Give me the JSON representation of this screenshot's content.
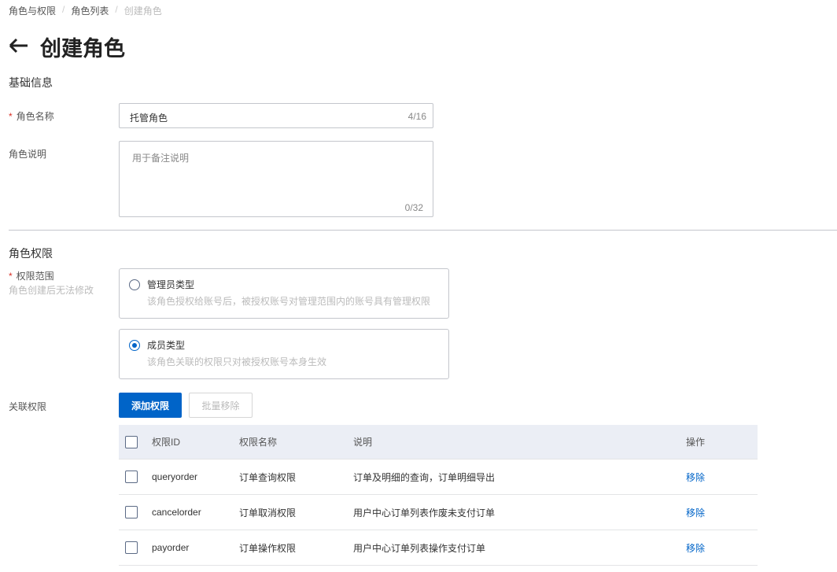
{
  "breadcrumb": [
    "角色与权限",
    "角色列表",
    "创建角色"
  ],
  "page_title": "创建角色",
  "basic": {
    "heading": "基础信息",
    "name_label": "角色名称",
    "name_value": "托管角色",
    "name_count": "4/16",
    "desc_label": "角色说明",
    "desc_placeholder": "用于备注说明",
    "desc_count": "0/32"
  },
  "perm": {
    "heading": "角色权限",
    "scope_label": "权限范围",
    "scope_hint": "角色创建后无法修改",
    "options": [
      {
        "title": "管理员类型",
        "desc": "该角色授权给账号后，被授权账号对管理范围内的账号具有管理权限",
        "selected": false
      },
      {
        "title": "成员类型",
        "desc": "该角色关联的权限只对被授权账号本身生效",
        "selected": true
      }
    ],
    "assoc_label": "关联权限",
    "add_button": "添加权限",
    "batch_remove_button": "批量移除"
  },
  "table": {
    "headers": [
      "权限ID",
      "权限名称",
      "说明",
      "操作"
    ],
    "rows": [
      {
        "id": "queryorder",
        "name": "订单查询权限",
        "desc": "订单及明细的查询，订单明细导出",
        "action": "移除"
      },
      {
        "id": "cancelorder",
        "name": "订单取消权限",
        "desc": "用户中心订单列表作废未支付订单",
        "action": "移除"
      },
      {
        "id": "payorder",
        "name": "订单操作权限",
        "desc": "用户中心订单列表操作支付订单",
        "action": "移除"
      }
    ]
  },
  "colors": {
    "primary": "#0064c8",
    "required": "#d93026"
  }
}
